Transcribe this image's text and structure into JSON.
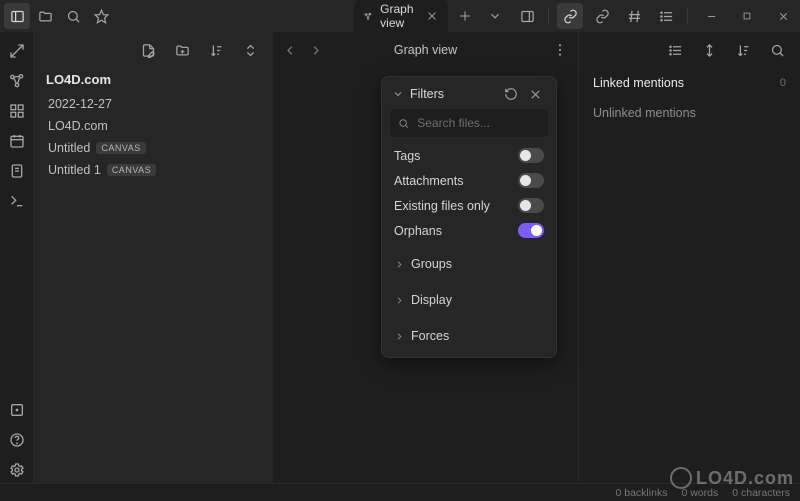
{
  "titlebar": {
    "tab": {
      "label": "Graph view"
    }
  },
  "sidebar": {
    "vault_name": "LO4D.com",
    "files": [
      {
        "name": "2022-12-27",
        "badge": null
      },
      {
        "name": "LO4D.com",
        "badge": null
      },
      {
        "name": "Untitled",
        "badge": "CANVAS"
      },
      {
        "name": "Untitled 1",
        "badge": "CANVAS"
      }
    ]
  },
  "main": {
    "title": "Graph view"
  },
  "filters": {
    "header": "Filters",
    "search_placeholder": "Search files...",
    "toggles": {
      "tags": {
        "label": "Tags",
        "on": false
      },
      "attachments": {
        "label": "Attachments",
        "on": false
      },
      "existing": {
        "label": "Existing files only",
        "on": false
      },
      "orphans": {
        "label": "Orphans",
        "on": true
      }
    },
    "sections": {
      "groups": "Groups",
      "display": "Display",
      "forces": "Forces"
    }
  },
  "right": {
    "linked": {
      "label": "Linked mentions",
      "count": "0"
    },
    "unlinked": {
      "label": "Unlinked mentions"
    }
  },
  "status": {
    "backlinks": "0 backlinks",
    "words": "0 words",
    "chars": "0 characters"
  },
  "watermark": "LO4D.com"
}
